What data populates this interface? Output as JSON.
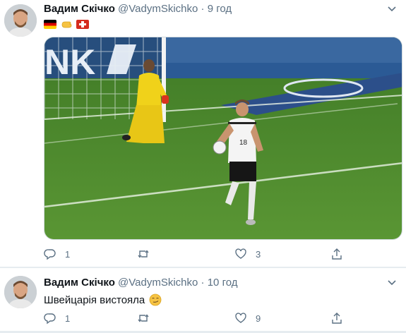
{
  "tweets": [
    {
      "author_name": "Вадим Скічко",
      "author_handle": "@VadymSkichko",
      "separator": "·",
      "time": "9 год",
      "text_icons": [
        "germany-flag",
        "hand-emoji",
        "switzerland-flag"
      ],
      "media_alt": "",
      "stats": {
        "replies": "1",
        "retweets": "",
        "likes": "3"
      }
    },
    {
      "author_name": "Вадим Скічко",
      "author_handle": "@VadymSkichko",
      "separator": "·",
      "time": "10 год",
      "text": "Швейцарія вистояла",
      "text_icons": [
        "smirk-emoji"
      ],
      "stats": {
        "replies": "1",
        "retweets": "",
        "likes": "9"
      }
    }
  ],
  "colors": {
    "text_primary": "#0f1419",
    "text_secondary": "#5b7083",
    "divider": "#e6ecf0",
    "pitch": "#4f8a2c",
    "ad_board": "#1f4e8c"
  }
}
